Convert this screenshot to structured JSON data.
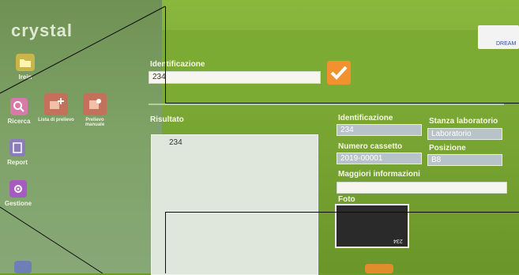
{
  "app": {
    "title": "crystal",
    "logo_text": "DREAM"
  },
  "sidebar": {
    "items": [
      {
        "label": "Irein",
        "icon": "folder-icon"
      },
      {
        "label": "Ricerca",
        "icon": "search-icon"
      },
      {
        "label": "Lista di prelievo",
        "icon": "add-list-icon"
      },
      {
        "label": "Prelievo manuale",
        "icon": "manual-sample-icon"
      },
      {
        "label": "Report",
        "icon": "document-icon"
      },
      {
        "label": "Gestione",
        "icon": "gear-icon"
      }
    ]
  },
  "search": {
    "label": "Identificazione",
    "value": "234"
  },
  "results": {
    "label": "Risultato",
    "items": [
      "234"
    ]
  },
  "details": {
    "identificazione_label": "Identificazione",
    "identificazione_value": "234",
    "stanza_label": "Stanza laboratorio",
    "stanza_value": "Laboratorio",
    "cassetto_label": "Numero cassetto",
    "cassetto_value": "2019-00001",
    "posizione_label": "Posizione",
    "posizione_value": "B8",
    "info_label": "Maggiori informazioni",
    "info_value": "",
    "foto_label": "Foto",
    "photo_text": "234"
  },
  "colors": {
    "accent": "#f1922f",
    "background": "#79a633"
  }
}
